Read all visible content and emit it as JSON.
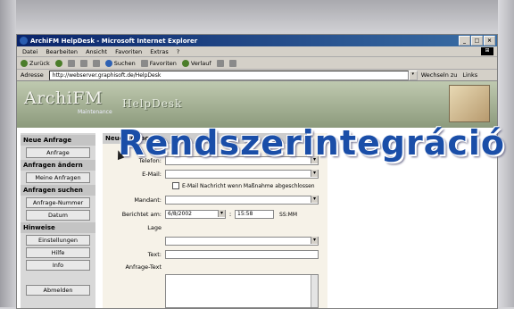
{
  "window": {
    "title": "ArchiFM HelpDesk - Microsoft Internet Explorer",
    "btn_min": "_",
    "btn_max": "□",
    "btn_close": "×"
  },
  "menu": [
    "Datei",
    "Bearbeiten",
    "Ansicht",
    "Favoriten",
    "Extras",
    "?"
  ],
  "toolbar": {
    "back": "Zurück",
    "search": "Suchen",
    "favorites": "Favoriten",
    "history": "Verlauf"
  },
  "address": {
    "label": "Adresse",
    "url": "http://webserver.graphisoft.de/HelpDesk",
    "go": "Wechseln zu",
    "links": "Links"
  },
  "banner": {
    "logo": "ArchiFM",
    "logo_sub": "Maintenance",
    "product": "HelpDesk"
  },
  "sidebar": {
    "sec_new": "Neue Anfrage",
    "btn_new": "Anfrage",
    "sec_my": "Anfragen ändern",
    "btn_my": "Meine Anfragen",
    "sec_search": "Anfragen suchen",
    "btn_num": "Anfrage-Nummer",
    "btn_date": "Datum",
    "sec_hints": "Hinweise",
    "btn_settings": "Einstellungen",
    "btn_help": "Hilfe",
    "btn_info": "Info",
    "btn_logout": "Abmelden"
  },
  "form": {
    "title": "Neue Anfrage",
    "phone_label": "Telefon:",
    "email_label": "E-Mail:",
    "email_notify": "E-Mail Nachricht wenn Maßnahme abgeschlossen",
    "client_label": "Mandant:",
    "reported_label": "Berichtet am:",
    "date_value": "6/8/2002",
    "time_value": "15:58",
    "time_format": "SS:MM",
    "location_label": "Lage",
    "text_label": "Text:",
    "request_text_label": "Anfrage-Text"
  },
  "overlay": "Rendszerintegráció"
}
